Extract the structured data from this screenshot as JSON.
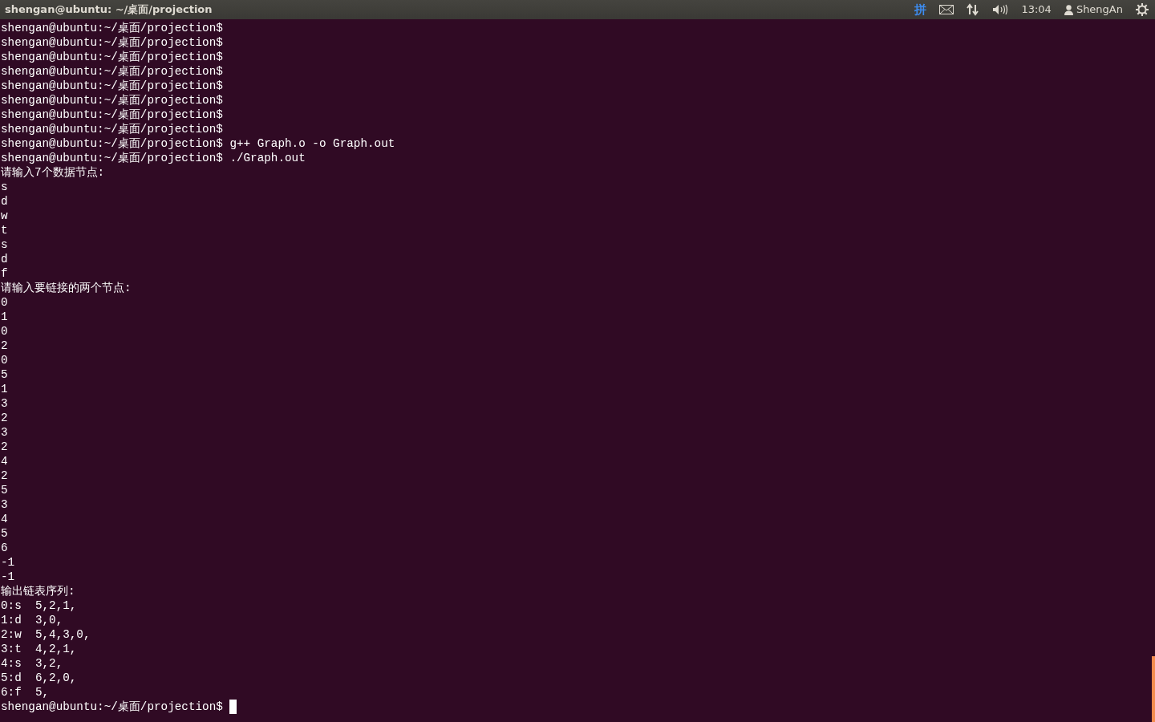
{
  "top_panel": {
    "title": "shengan@ubuntu: ~/桌面/projection",
    "input_method": "拼",
    "time": "13:04",
    "user": "ShengAn"
  },
  "terminal": {
    "lines": [
      "shengan@ubuntu:~/桌面/projection$",
      "shengan@ubuntu:~/桌面/projection$",
      "shengan@ubuntu:~/桌面/projection$",
      "shengan@ubuntu:~/桌面/projection$",
      "shengan@ubuntu:~/桌面/projection$",
      "shengan@ubuntu:~/桌面/projection$",
      "shengan@ubuntu:~/桌面/projection$",
      "shengan@ubuntu:~/桌面/projection$",
      "shengan@ubuntu:~/桌面/projection$ g++ Graph.o -o Graph.out",
      "shengan@ubuntu:~/桌面/projection$ ./Graph.out",
      "请输入7个数据节点:",
      "s",
      "d",
      "w",
      "t",
      "s",
      "d",
      "f",
      "请输入要链接的两个节点:",
      "0",
      "1",
      "0",
      "2",
      "0",
      "5",
      "1",
      "3",
      "2",
      "3",
      "2",
      "4",
      "2",
      "5",
      "3",
      "4",
      "5",
      "6",
      "-1",
      "-1",
      "输出链表序列:",
      "0:s  5,2,1,",
      "1:d  3,0,",
      "2:w  5,4,3,0,",
      "3:t  4,2,1,",
      "4:s  3,2,",
      "5:d  6,2,0,",
      "6:f  5,",
      "shengan@ubuntu:~/桌面/projection$ "
    ],
    "cursor_visible": true
  }
}
